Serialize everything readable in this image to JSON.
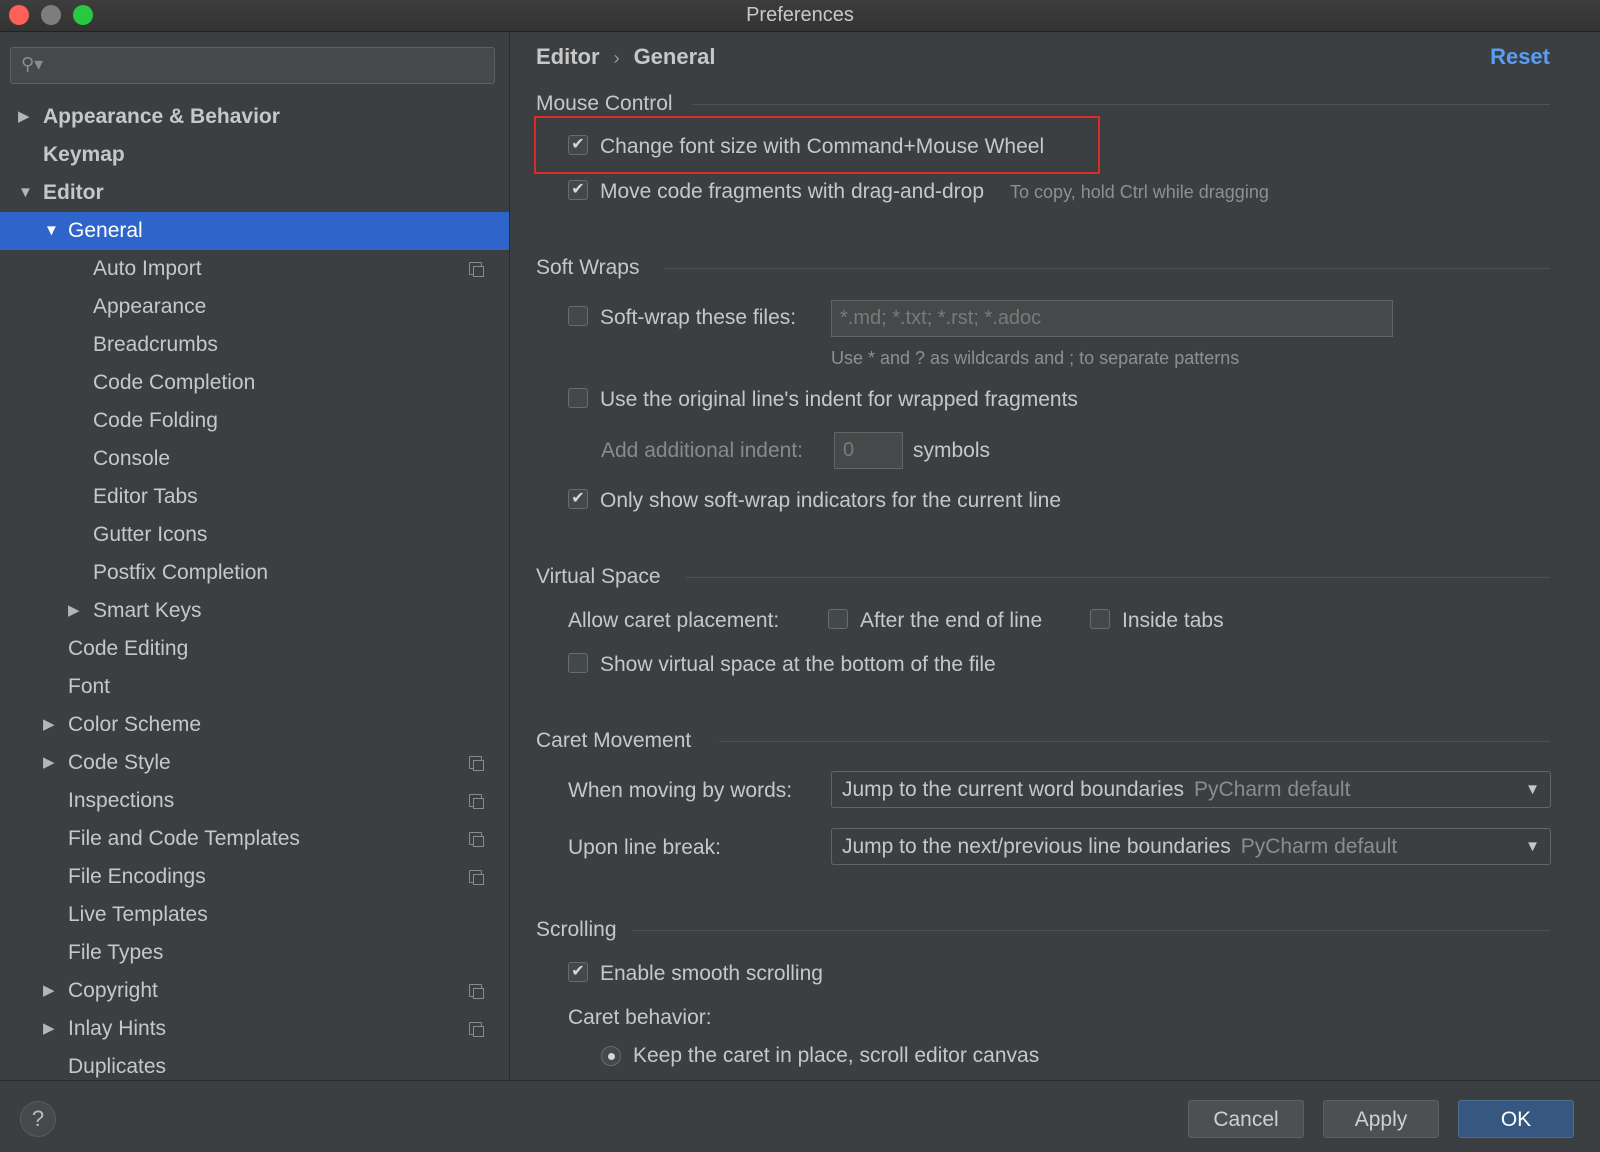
{
  "window": {
    "title": "Preferences"
  },
  "search": {
    "placeholder": ""
  },
  "sidebar": {
    "items": [
      {
        "label": "Appearance & Behavior"
      },
      {
        "label": "Keymap"
      },
      {
        "label": "Editor"
      },
      {
        "label": "General"
      },
      {
        "label": "Auto Import"
      },
      {
        "label": "Appearance"
      },
      {
        "label": "Breadcrumbs"
      },
      {
        "label": "Code Completion"
      },
      {
        "label": "Code Folding"
      },
      {
        "label": "Console"
      },
      {
        "label": "Editor Tabs"
      },
      {
        "label": "Gutter Icons"
      },
      {
        "label": "Postfix Completion"
      },
      {
        "label": "Smart Keys"
      },
      {
        "label": "Code Editing"
      },
      {
        "label": "Font"
      },
      {
        "label": "Color Scheme"
      },
      {
        "label": "Code Style"
      },
      {
        "label": "Inspections"
      },
      {
        "label": "File and Code Templates"
      },
      {
        "label": "File Encodings"
      },
      {
        "label": "Live Templates"
      },
      {
        "label": "File Types"
      },
      {
        "label": "Copyright"
      },
      {
        "label": "Inlay Hints"
      },
      {
        "label": "Duplicates"
      }
    ]
  },
  "breadcrumb": {
    "parent": "Editor",
    "current": "General",
    "separator": "›"
  },
  "reset_label": "Reset",
  "mouse_control": {
    "title": "Mouse Control",
    "change_font_size": {
      "label": "Change font size with Command+Mouse Wheel",
      "checked": true
    },
    "move_fragments": {
      "label": "Move code fragments with drag-and-drop",
      "checked": true,
      "hint": "To copy, hold Ctrl while dragging"
    }
  },
  "soft_wraps": {
    "title": "Soft Wraps",
    "soft_wrap_files": {
      "label": "Soft-wrap these files:",
      "checked": false,
      "placeholder": "*.md; *.txt; *.rst; *.adoc"
    },
    "wildcard_hint": "Use * and ? as wildcards and ; to separate patterns",
    "original_indent": {
      "label": "Use the original line's indent for wrapped fragments",
      "checked": false
    },
    "additional_indent": {
      "label": "Add additional indent:",
      "value": "0",
      "unit": "symbols"
    },
    "only_current_line": {
      "label": "Only show soft-wrap indicators for the current line",
      "checked": true
    }
  },
  "virtual_space": {
    "title": "Virtual Space",
    "caret_placement_label": "Allow caret placement:",
    "after_end_of_line": {
      "label": "After the end of line",
      "checked": false
    },
    "inside_tabs": {
      "label": "Inside tabs",
      "checked": false
    },
    "show_virtual_space": {
      "label": "Show virtual space at the bottom of the file",
      "checked": false
    }
  },
  "caret_movement": {
    "title": "Caret Movement",
    "moving_by_words": {
      "label": "When moving by words:",
      "value": "Jump to the current word boundaries",
      "default": "PyCharm default"
    },
    "line_break": {
      "label": "Upon line break:",
      "value": "Jump to the next/previous line boundaries",
      "default": "PyCharm default"
    }
  },
  "scrolling": {
    "title": "Scrolling",
    "smooth_scrolling": {
      "label": "Enable smooth scrolling",
      "checked": true
    },
    "caret_behavior_label": "Caret behavior:",
    "keep_caret": {
      "label": "Keep the caret in place, scroll editor canvas",
      "selected": true
    }
  },
  "footer": {
    "help": "?",
    "cancel": "Cancel",
    "apply": "Apply",
    "ok": "OK"
  },
  "colors": {
    "accent": "#2f65ca",
    "link": "#589df6",
    "highlight": "#d82c27",
    "background": "#3c3f41"
  }
}
